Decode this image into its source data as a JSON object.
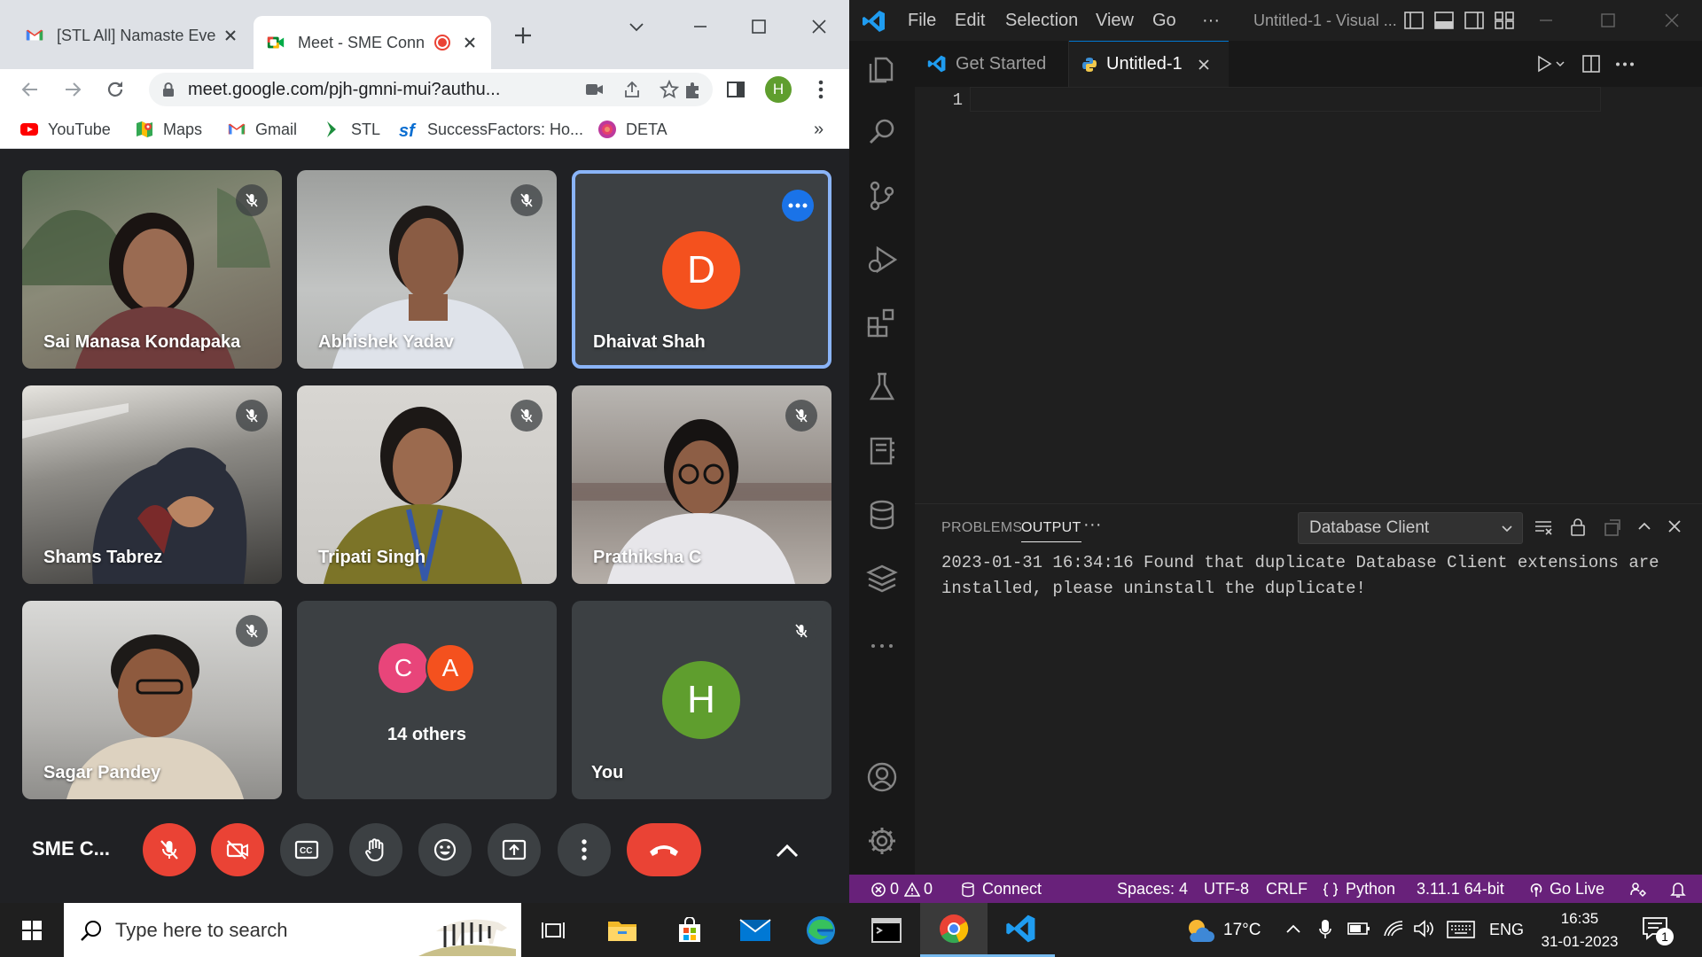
{
  "browser": {
    "tabs": [
      {
        "title": "[STL All] Namaste Ever",
        "icon": "gmail-icon"
      },
      {
        "title": "Meet - SME Conn",
        "icon": "meet-icon",
        "recording": true
      }
    ],
    "url": "meet.google.com/pjh-gmni-mui?authu...",
    "profile_initial": "H",
    "bookmarks": [
      "YouTube",
      "Maps",
      "Gmail",
      "STL",
      "SuccessFactors: Ho...",
      "DETA"
    ],
    "bookmarks_more": "»"
  },
  "meet": {
    "participants": [
      {
        "name": "Sai Manasa Kondapaka",
        "muted": true,
        "video": true
      },
      {
        "name": "Abhishek Yadav",
        "muted": true,
        "video": true
      },
      {
        "name": "Dhaivat Shah",
        "muted": false,
        "video": false,
        "initial": "D",
        "color": "#f4511e",
        "active_speaker": true
      },
      {
        "name": "Shams Tabrez",
        "muted": true,
        "video": true
      },
      {
        "name": "Tripati Singh",
        "muted": true,
        "video": true
      },
      {
        "name": "Prathiksha C",
        "muted": true,
        "video": true
      },
      {
        "name": "Sagar Pandey",
        "muted": true,
        "video": true
      }
    ],
    "others": {
      "label": "14 others",
      "initials": [
        "C",
        "A"
      ],
      "colors": [
        "#e8457a",
        "#f4511e"
      ]
    },
    "self": {
      "name": "You",
      "initial": "H",
      "color": "#5f9e2e",
      "muted": true
    },
    "meeting_name": "SME C...",
    "accent": "#1a73e8"
  },
  "vscode": {
    "menu": [
      "File",
      "Edit",
      "Selection",
      "View",
      "Go",
      "···"
    ],
    "window_title": "Untitled-1 - Visual ...",
    "tabs": [
      {
        "label": "Get Started",
        "active": false
      },
      {
        "label": "Untitled-1",
        "active": true
      }
    ],
    "line_number": "1",
    "panel": {
      "tabs": [
        "PROBLEMS",
        "OUTPUT"
      ],
      "more": "···",
      "channel": "Database Client",
      "output": "2023-01-31 16:34:16 Found that duplicate Database Client extensions are installed, please uninstall the duplicate!"
    },
    "status": {
      "errors": "0",
      "warnings": "0",
      "connect": "Connect",
      "spaces": "Spaces: 4",
      "encoding": "UTF-8",
      "eol": "CRLF",
      "language": "Python",
      "interpreter": "3.11.1 64-bit",
      "golive": "Go Live",
      "color": "#68217a"
    }
  },
  "taskbar": {
    "search_placeholder": "Type here to search",
    "weather": "17°C",
    "language": "ENG",
    "time": "16:35",
    "date": "31-01-2023",
    "notifications": "1"
  }
}
